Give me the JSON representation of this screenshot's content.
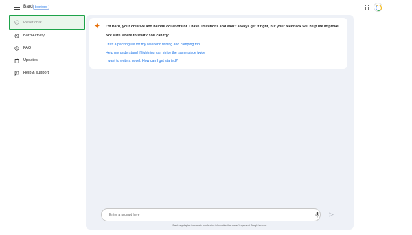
{
  "header": {
    "brand": "Bard",
    "badge": "Experiment"
  },
  "sidebar": {
    "items": [
      {
        "label": "Reset chat",
        "icon": "reset-icon"
      },
      {
        "label": "Bard Activity",
        "icon": "history-icon"
      },
      {
        "label": "FAQ",
        "icon": "help-circle-icon"
      },
      {
        "label": "Updates",
        "icon": "calendar-icon"
      },
      {
        "label": "Help & support",
        "icon": "feedback-icon"
      }
    ]
  },
  "welcome": {
    "intro": "I'm Bard, your creative and helpful collaborator. I have limitations and won't always get it right, but your feedback will help me improve.",
    "try_label": "Not sure where to start? You can try:",
    "suggestions": [
      "Draft a packing list for my weekend fishing and camping trip",
      "Help me understand if lightning can strike the same place twice",
      "I want to write a novel. How can I get started?"
    ]
  },
  "prompt": {
    "placeholder": "Enter a prompt here",
    "value": ""
  },
  "disclaimer": "Bard may display inaccurate or offensive information that doesn't represent Google's views.",
  "colors": {
    "accent": "#1a73e8",
    "active_border": "#1ea34a",
    "active_bg": "#eaf6ec",
    "main_bg": "#eef1f7"
  }
}
